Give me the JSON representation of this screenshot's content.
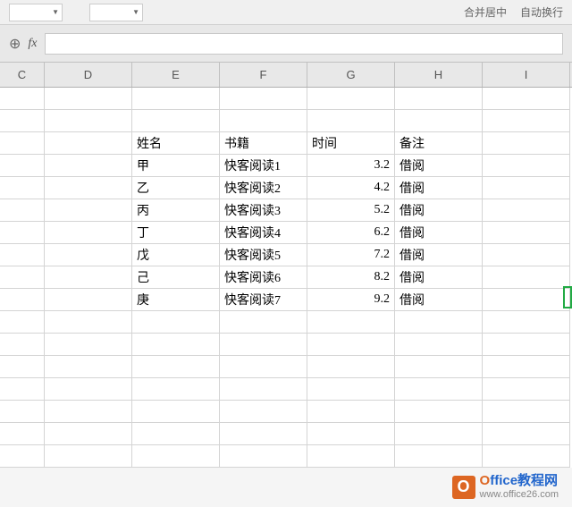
{
  "toolbar": {
    "right1": "合并居中",
    "right2": "自动换行"
  },
  "formula": {
    "fx": "fx",
    "value": ""
  },
  "columns": [
    "C",
    "D",
    "E",
    "F",
    "G",
    "H",
    "I"
  ],
  "header_row": {
    "name": "姓名",
    "book": "书籍",
    "time": "时间",
    "note": "备注"
  },
  "rows": [
    {
      "name": "甲",
      "book": "快客阅读1",
      "time": "3.2",
      "note": "借阅"
    },
    {
      "name": "乙",
      "book": "快客阅读2",
      "time": "4.2",
      "note": "借阅"
    },
    {
      "name": "丙",
      "book": "快客阅读3",
      "time": "5.2",
      "note": "借阅"
    },
    {
      "name": "丁",
      "book": "快客阅读4",
      "time": "6.2",
      "note": "借阅"
    },
    {
      "name": "戊",
      "book": "快客阅读5",
      "time": "7.2",
      "note": "借阅"
    },
    {
      "name": "己",
      "book": "快客阅读6",
      "time": "8.2",
      "note": "借阅"
    },
    {
      "name": "庚",
      "book": "快客阅读7",
      "time": "9.2",
      "note": "借阅"
    }
  ],
  "watermark": {
    "icon": "O",
    "title_o": "O",
    "title_rest": "ffice教程网",
    "url": "www.office26.com"
  }
}
